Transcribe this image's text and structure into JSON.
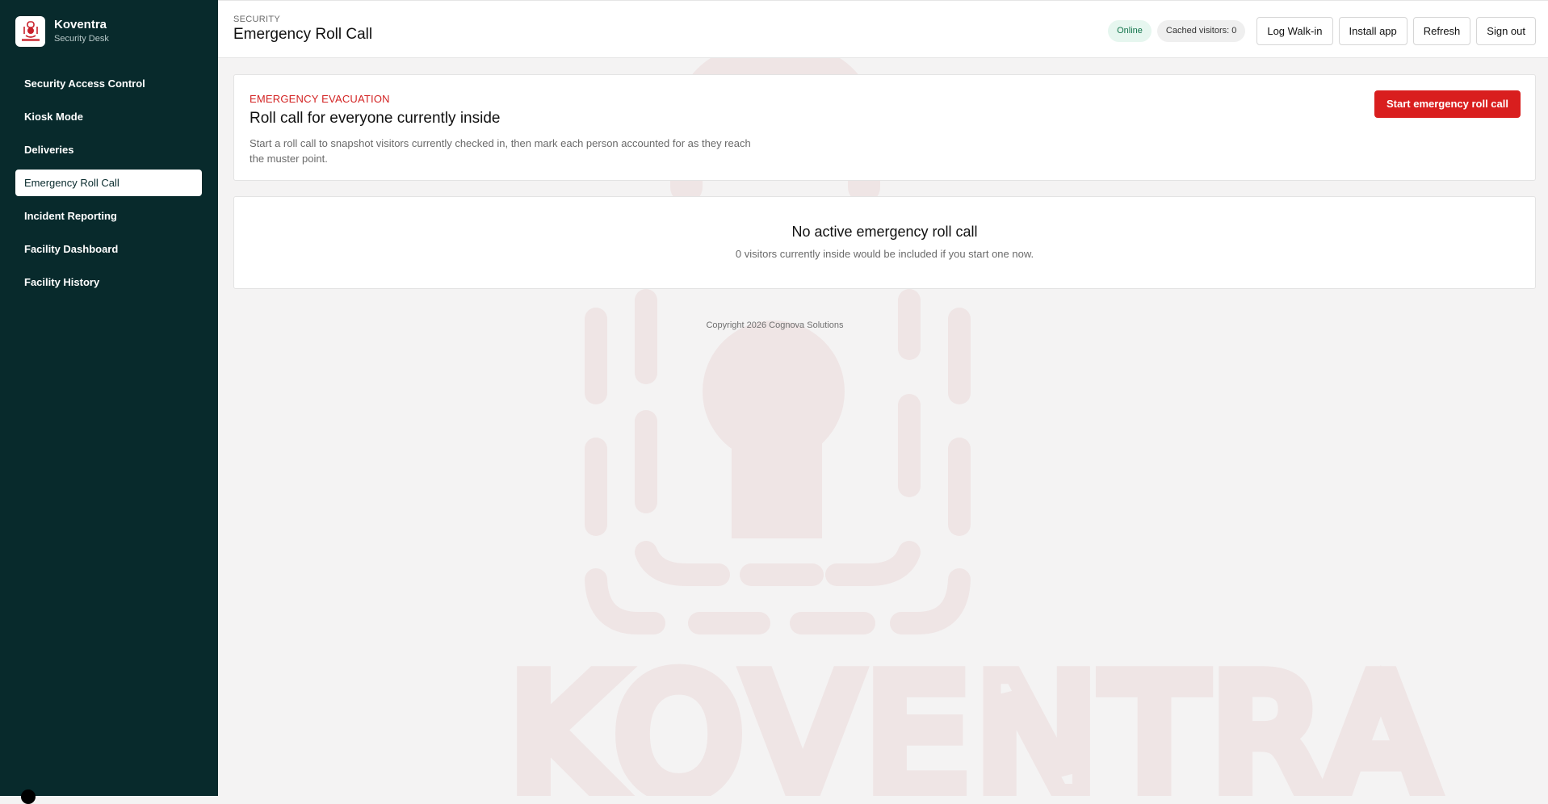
{
  "brand": {
    "name": "Koventra",
    "subtitle": "Security Desk",
    "logo_icon": "koventra-logo-icon"
  },
  "sidebar": {
    "items": [
      {
        "label": "Security Access Control",
        "active": false
      },
      {
        "label": "Kiosk Mode",
        "active": false
      },
      {
        "label": "Deliveries",
        "active": false
      },
      {
        "label": "Emergency Roll Call",
        "active": true
      },
      {
        "label": "Incident Reporting",
        "active": false
      },
      {
        "label": "Facility Dashboard",
        "active": false
      },
      {
        "label": "Facility History",
        "active": false
      }
    ]
  },
  "header": {
    "breadcrumb": "SECURITY",
    "title": "Emergency Roll Call",
    "status": "Online",
    "cached": "Cached visitors: 0",
    "actions": {
      "walkin": "Log Walk-in",
      "install": "Install app",
      "refresh": "Refresh",
      "signout": "Sign out"
    }
  },
  "evacuation": {
    "label": "EMERGENCY EVACUATION",
    "title": "Roll call for everyone currently inside",
    "description": "Start a roll call to snapshot visitors currently checked in, then mark each person accounted for as they reach the muster point.",
    "button": "Start emergency roll call"
  },
  "rollcall": {
    "title": "No active emergency roll call",
    "description": "0 visitors currently inside would be included if you start one now."
  },
  "footer": {
    "copyright": "Copyright 2026 Cognova Solutions"
  },
  "watermark": {
    "text": "KOVENTRA",
    "icon": "koventra-watermark-icon"
  },
  "colors": {
    "sidebar": "#082a2c",
    "accent": "#d91e1e",
    "online": "#12744b"
  }
}
